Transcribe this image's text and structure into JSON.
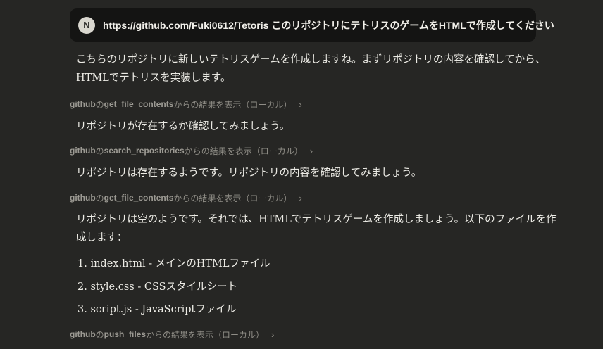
{
  "user_message": {
    "avatar_initial": "N",
    "text": "https://github.com/Fuki0612/Tetoris このリポジトリにテトリスのゲームをHTMLで作成してください"
  },
  "assistant": {
    "intro": "こちらのリポジトリに新しいテトリスゲームを作成しますね。まずリポジトリの内容を確認してから、HTMLでテトリスを実装します。",
    "tool_calls": [
      {
        "server": "github",
        "sep": "の",
        "name": "get_file_contents",
        "suffix": "からの結果を表示（ローカル）",
        "chevron": "›"
      },
      {
        "server": "github",
        "sep": "の",
        "name": "search_repositories",
        "suffix": "からの結果を表示（ローカル）",
        "chevron": "›"
      },
      {
        "server": "github",
        "sep": "の",
        "name": "get_file_contents",
        "suffix": "からの結果を表示（ローカル）",
        "chevron": "›"
      },
      {
        "server": "github",
        "sep": "の",
        "name": "push_files",
        "suffix": "からの結果を表示（ローカル）",
        "chevron": "›"
      }
    ],
    "msg_check": "リポジトリが存在するか確認してみましょう。",
    "msg_exists": "リポジトリは存在するようです。リポジトリの内容を確認してみましょう。",
    "msg_empty": "リポジトリは空のようです。それでは、HTMLでテトリスゲームを作成しましょう。以下のファイルを作成します：",
    "files": [
      "1. index.html - メインのHTMLファイル",
      "2. style.css - CSSスタイルシート",
      "3. script.js - JavaScriptファイル"
    ]
  }
}
